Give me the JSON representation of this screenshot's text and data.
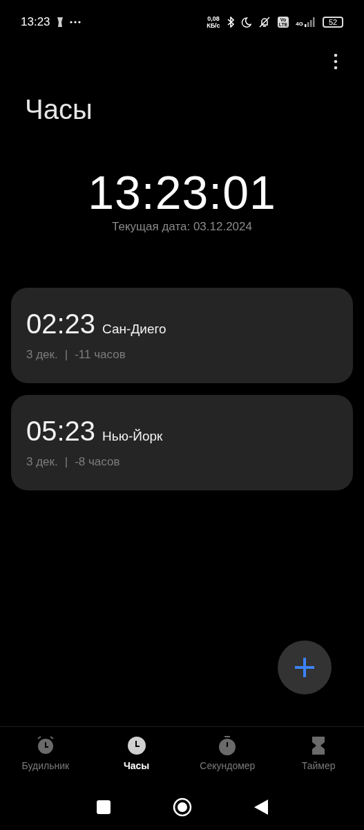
{
  "status_bar": {
    "time": "13:23",
    "speed_value": "0,08",
    "speed_unit": "КБ/с",
    "volte_top": "Vo",
    "volte_bottom": "LTE",
    "network": "4G",
    "battery": "52"
  },
  "title": "Часы",
  "clock": {
    "time": "13:23:01",
    "date": "Текущая дата: 03.12.2024"
  },
  "cities": [
    {
      "time": "02:23",
      "city": "Сан-Диего",
      "date": "3 дек.",
      "separator": "|",
      "offset": "-11 часов"
    },
    {
      "time": "05:23",
      "city": "Нью-Йорк",
      "date": "3 дек.",
      "separator": "|",
      "offset": "-8 часов"
    }
  ],
  "tabs": [
    {
      "kind": "alarm",
      "label": "Будильник",
      "selected": false
    },
    {
      "kind": "clock",
      "label": "Часы",
      "selected": true
    },
    {
      "kind": "stopwatch",
      "label": "Секундомер",
      "selected": false
    },
    {
      "kind": "timer",
      "label": "Таймер",
      "selected": false
    }
  ]
}
